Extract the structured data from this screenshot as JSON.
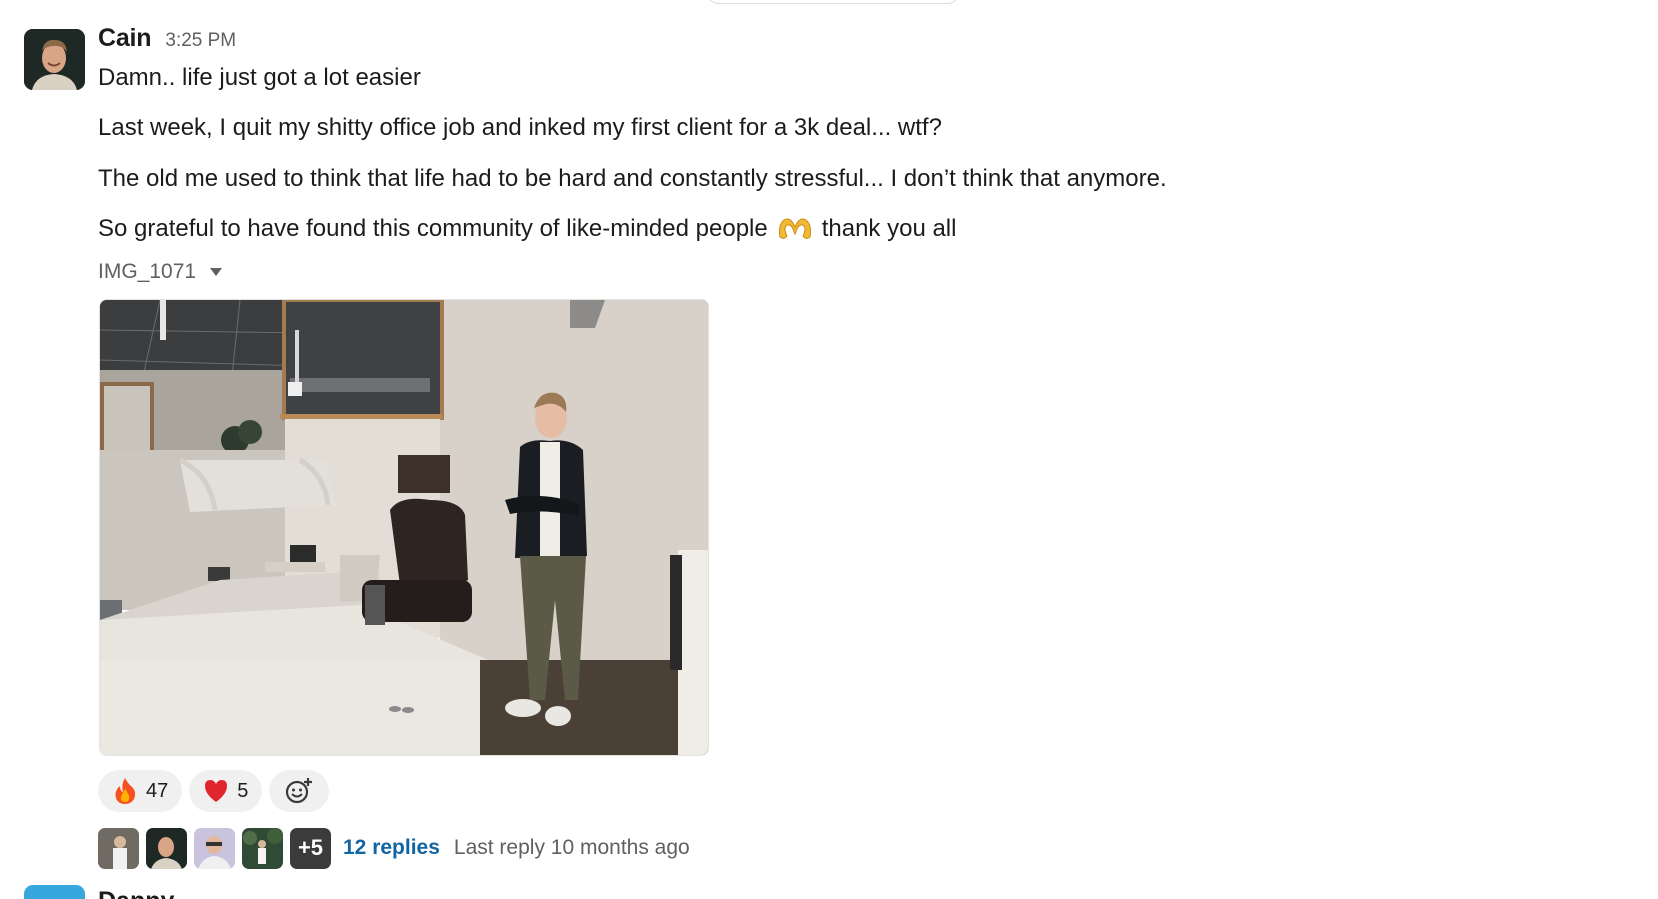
{
  "message": {
    "author": "Cain",
    "time": "3:25 PM",
    "lines": [
      "Damn.. life just got a lot easier",
      "Last week, I quit my shitty office job and inked my first client for a 3k deal... wtf?",
      "The old me used to think that life had to be hard and constantly stressful... I don’t think that anymore.",
      "So grateful to have found this community of like-minded people"
    ],
    "line4_suffix": "thank you all",
    "attachment_name": "IMG_1071"
  },
  "reactions": [
    {
      "emoji": "fire-icon",
      "count": "47"
    },
    {
      "emoji": "red-heart-icon",
      "count": "5"
    }
  ],
  "thread": {
    "more_count": "+5",
    "replies_label": "12 replies",
    "last_reply": "Last reply 10 months ago"
  },
  "next_message": {
    "author": "Danny Ploughman"
  },
  "colors": {
    "link": "#1264a3",
    "muted": "#616061",
    "reaction_bg": "#f0f0f0"
  }
}
